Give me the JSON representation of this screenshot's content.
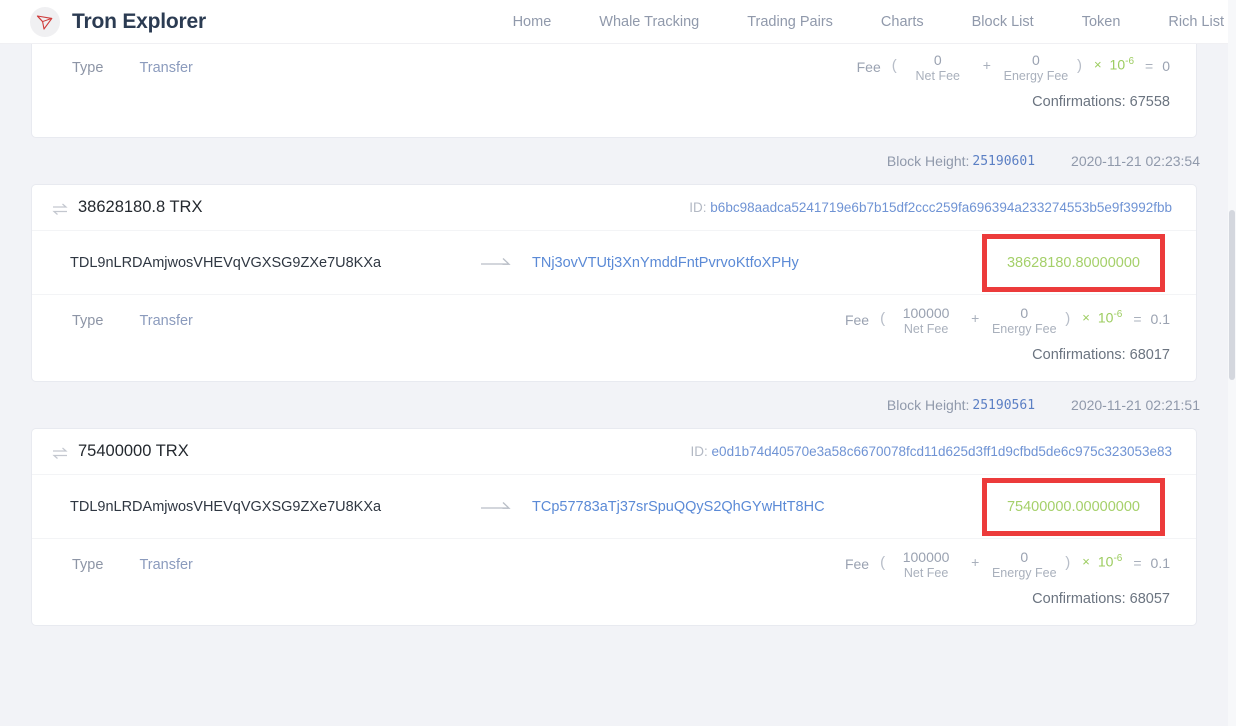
{
  "header": {
    "brand_title": "Tron Explorer",
    "logo_icon": "tron-logo-icon",
    "nav": [
      {
        "label": "Home"
      },
      {
        "label": "Whale Tracking"
      },
      {
        "label": "Trading Pairs"
      },
      {
        "label": "Charts"
      },
      {
        "label": "Block List"
      },
      {
        "label": "Token"
      },
      {
        "label": "Rich List"
      }
    ]
  },
  "colors": {
    "brand_text": "#2b3b52",
    "link_blue": "#5b8ad6",
    "amount_green": "#a5d06a",
    "highlight_red": "#ec3b3b",
    "page_bg": "#f2f3f7"
  },
  "labels": {
    "fee_word": "Fee",
    "paren_open": "(",
    "paren_close": ")",
    "plus": "+",
    "times": "×",
    "equals": "=",
    "power_base": "10",
    "power_exp": "-6",
    "net_fee": "Net Fee",
    "energy_fee": "Energy Fee",
    "type_label": "Type",
    "block_height_label": "Block Height:",
    "id_label": "ID:",
    "confirmations_prefix": "Confirmations:"
  },
  "transactions": [
    {
      "clipped_top": true,
      "type_value": "Transfer",
      "net_fee": "0",
      "energy_fee": "0",
      "fee_total": "0",
      "confirmations": "Confirmations: 67558"
    },
    {
      "block_height": "25190601",
      "timestamp": "2020-11-21 02:23:54",
      "amount_title": "38628180.8 TRX",
      "tx_id": "b6bc98aadca5241719e6b7b15df2ccc259fa696394a233274553b5e9f3992fbb",
      "from_address": "TDL9nLRDAmjwosVHEVqVGXSG9ZXe7U8KXa",
      "to_address": "TNj3ovVTUtj3XnYmddFntPvrvoKtfoXPHy",
      "amount_value": "38628180.80000000",
      "amount_highlighted": true,
      "type_value": "Transfer",
      "net_fee": "100000",
      "energy_fee": "0",
      "fee_total": "0.1",
      "confirmations": "Confirmations: 68017"
    },
    {
      "block_height": "25190561",
      "timestamp": "2020-11-21 02:21:51",
      "amount_title": "75400000 TRX",
      "tx_id": "e0d1b74d40570e3a58c6670078fcd11d625d3ff1d9cfbd5de6c975c323053e83",
      "from_address": "TDL9nLRDAmjwosVHEVqVGXSG9ZXe7U8KXa",
      "to_address": "TCp57783aTj37srSpuQQyS2QhGYwHtT8HC",
      "amount_value": "75400000.00000000",
      "amount_highlighted": true,
      "type_value": "Transfer",
      "net_fee": "100000",
      "energy_fee": "0",
      "fee_total": "0.1",
      "confirmations": "Confirmations: 68057"
    }
  ]
}
